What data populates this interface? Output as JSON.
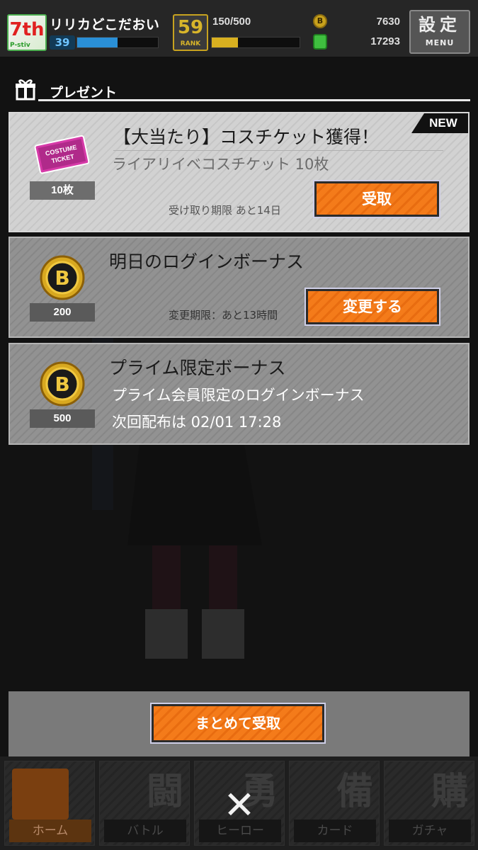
{
  "status_bar": {
    "player_name": "リリカどこだおい",
    "level": "39",
    "exp_progress": 0.5,
    "rank": "59",
    "rank_label": "RANK",
    "stamina": "150/500",
    "stamina_progress": 0.3,
    "coins": "7630",
    "coin_icon_letter": "B",
    "gems": "17293",
    "menu_kanji": "設定",
    "menu_label": "MENU",
    "avatar_text": "7th",
    "avatar_small": "P-stiv"
  },
  "panel": {
    "title": "プレゼント"
  },
  "gifts": [
    {
      "title": "【大当たり】コスチケット獲得！",
      "description": "ライアリイベコスチケット 10枚",
      "quantity": "10枚",
      "deadline": "受け取り期限 あと14日",
      "button": "受取",
      "badge": "NEW",
      "icon": "costume-ticket-icon",
      "ticket_text": "COSTUME TICKET"
    },
    {
      "title": "明日のログインボーナス",
      "quantity": "200",
      "deadline": "変更期限：あと13時間",
      "button": "変更する",
      "icon": "coin-icon"
    },
    {
      "title": "プライム限定ボーナス",
      "description": "プライム会員限定のログインボーナス",
      "description2": "次回配布は 02/01 17:28",
      "quantity": "500",
      "icon": "coin-icon"
    }
  ],
  "collect_all": {
    "label": "まとめて受取"
  },
  "bottom_nav": [
    {
      "label": "ホーム",
      "icon": "home-icon",
      "glyph": "⮐"
    },
    {
      "label": "バトル",
      "icon": "battle-icon",
      "glyph": "闘"
    },
    {
      "label": "ヒーロー",
      "icon": "hero-icon",
      "glyph": "勇"
    },
    {
      "label": "カード",
      "icon": "card-icon",
      "glyph": "備"
    },
    {
      "label": "ガチャ",
      "icon": "gacha-icon",
      "glyph": "購"
    }
  ],
  "close_glyph": "✕",
  "colors": {
    "accent_orange": "#f47b1a",
    "card_light": "#d2d2d2",
    "card_dim": "#929292",
    "exp_blue": "#2a8fd6",
    "stamina_yellow": "#d8b020"
  }
}
